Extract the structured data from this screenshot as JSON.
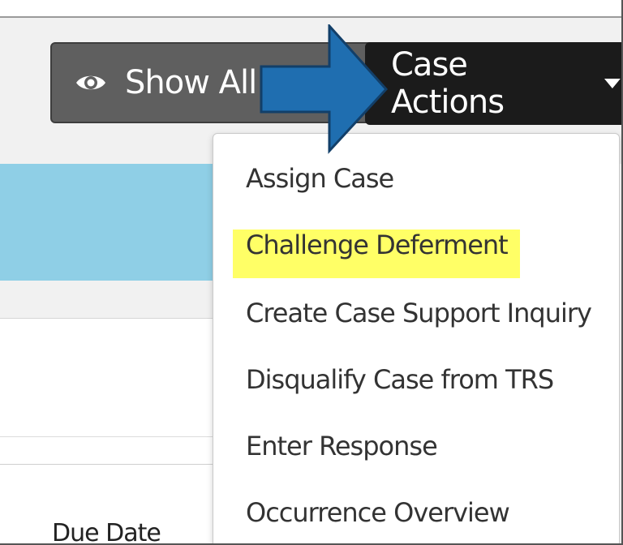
{
  "toolbar": {
    "show_all_fields_label": "Show All Fi",
    "case_actions_label": "Case Actions"
  },
  "case_actions_menu": {
    "items": [
      {
        "label": "Assign Case"
      },
      {
        "label": "Challenge Deferment",
        "highlighted": true
      },
      {
        "label": "Create Case Support Inquiry"
      },
      {
        "label": "Disqualify Case from TRS"
      },
      {
        "label": "Enter Response"
      },
      {
        "label": "Occurrence Overview"
      }
    ]
  },
  "table": {
    "due_date_header": "Due Date"
  },
  "icons": {
    "show_fields_icon": "eye-icon",
    "case_actions_caret": "caret-down-icon",
    "annotation_arrow": "right-arrow-icon"
  },
  "colors": {
    "show_fields_button_bg": "#5f5f5f",
    "case_actions_button_bg": "#1b1b1b",
    "info_banner_bg": "#8fcfe6",
    "highlight": "#ffff66",
    "annotation_arrow": "#1f6eb0"
  }
}
